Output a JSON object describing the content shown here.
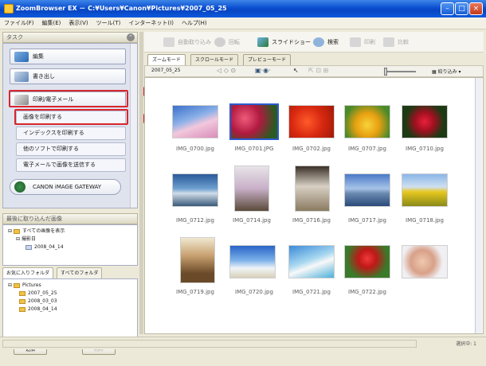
{
  "window": {
    "title": "ZoomBrowser EX － C:¥Users¥Canon¥Pictures¥2007_05_25"
  },
  "menu": [
    "ファイル(F)",
    "編集(E)",
    "表示(V)",
    "ツール(T)",
    "インターネット(I)",
    "ヘルプ(H)"
  ],
  "tasks": {
    "header": "タスク",
    "items": [
      {
        "label": "編集"
      },
      {
        "label": "書き出し"
      },
      {
        "label": "印刷/電子メール"
      }
    ],
    "subitems": [
      {
        "label": "画像を印刷する"
      },
      {
        "label": "インデックスを印刷する"
      },
      {
        "label": "他のソフトで印刷する"
      },
      {
        "label": "電子メールで画像を送信する"
      }
    ],
    "gateway": "CANON iMAGE GATEWAY"
  },
  "callouts": [
    "①",
    "②"
  ],
  "recent": {
    "header": "最後に取り込んだ画像",
    "items": [
      "すべての画像を表示",
      "撮影日",
      "2008_04_14"
    ]
  },
  "folders": {
    "tabs": [
      "お気に入りフォルダ",
      "すべてのフォルダ"
    ],
    "items": [
      "Pictures",
      "2007_05_25",
      "2008_03_03",
      "2008_04_14"
    ],
    "add_button": "追加",
    "remove_button": "削除"
  },
  "toolbar": {
    "buttons": [
      "自動取り込み",
      "回転",
      "スライドショー",
      "検索",
      "印刷",
      "比較"
    ]
  },
  "view_tabs": [
    "ズームモード",
    "スクロールモード",
    "プレビューモード"
  ],
  "viewbar": {
    "folder": "2007_05_25",
    "filter": "絞り込み"
  },
  "images": [
    {
      "file": "IMG_0700.jpg"
    },
    {
      "file": "IMG_0701.JPG"
    },
    {
      "file": "IMG_0702.jpg"
    },
    {
      "file": "IMG_0707.jpg"
    },
    {
      "file": "IMG_0710.jpg"
    },
    {
      "file": "IMG_0712.jpg"
    },
    {
      "file": "IMG_0714.jpg"
    },
    {
      "file": "IMG_0716.jpg"
    },
    {
      "file": "IMG_0717.jpg"
    },
    {
      "file": "IMG_0718.jpg"
    },
    {
      "file": "IMG_0719.jpg"
    },
    {
      "file": "IMG_0720.jpg"
    },
    {
      "file": "IMG_0721.jpg"
    },
    {
      "file": "IMG_0722.jpg"
    }
  ],
  "status": "選択中: 1",
  "colors": {
    "highlight": "#d8262e",
    "titlebar": "#0a4fd0"
  }
}
